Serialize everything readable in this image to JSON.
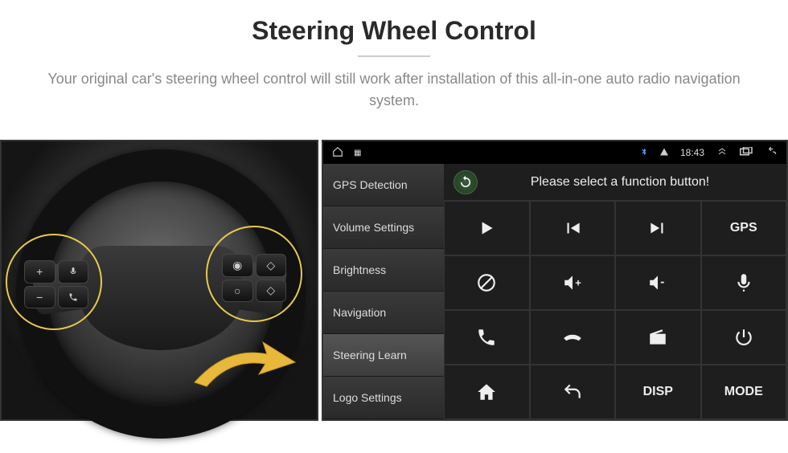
{
  "header": {
    "title": "Steering Wheel Control",
    "subtitle": "Your original car's steering wheel control will still work after installation of this all-in-one auto radio navigation system."
  },
  "wheel": {
    "left_buttons": [
      "+",
      "voice",
      "−",
      "phone"
    ],
    "right_buttons": [
      "media",
      "nav-up",
      "cycle",
      "nav-down"
    ]
  },
  "status_bar": {
    "time": "18:43",
    "icons_left": [
      "home-outline",
      "apps"
    ],
    "icons_right": [
      "bluetooth",
      "signal",
      "chevron-up",
      "recents",
      "back"
    ]
  },
  "sidebar": {
    "items": [
      {
        "label": "GPS Detection",
        "selected": false
      },
      {
        "label": "Volume Settings",
        "selected": false
      },
      {
        "label": "Brightness",
        "selected": false
      },
      {
        "label": "Navigation",
        "selected": false
      },
      {
        "label": "Steering Learn",
        "selected": true
      },
      {
        "label": "Logo Settings",
        "selected": false
      }
    ]
  },
  "main": {
    "header_text": "Please select a function button!",
    "buttons": [
      {
        "name": "play",
        "type": "icon"
      },
      {
        "name": "prev-track",
        "type": "icon"
      },
      {
        "name": "next-track",
        "type": "icon"
      },
      {
        "name": "gps",
        "type": "text",
        "label": "GPS"
      },
      {
        "name": "mute",
        "type": "icon"
      },
      {
        "name": "volume-up",
        "type": "icon"
      },
      {
        "name": "volume-down",
        "type": "icon"
      },
      {
        "name": "mic",
        "type": "icon"
      },
      {
        "name": "call-answer",
        "type": "icon"
      },
      {
        "name": "call-end",
        "type": "icon"
      },
      {
        "name": "radio",
        "type": "icon"
      },
      {
        "name": "power",
        "type": "icon"
      },
      {
        "name": "home",
        "type": "icon"
      },
      {
        "name": "return",
        "type": "icon"
      },
      {
        "name": "disp",
        "type": "text",
        "label": "DISP"
      },
      {
        "name": "mode",
        "type": "text",
        "label": "MODE"
      }
    ]
  }
}
